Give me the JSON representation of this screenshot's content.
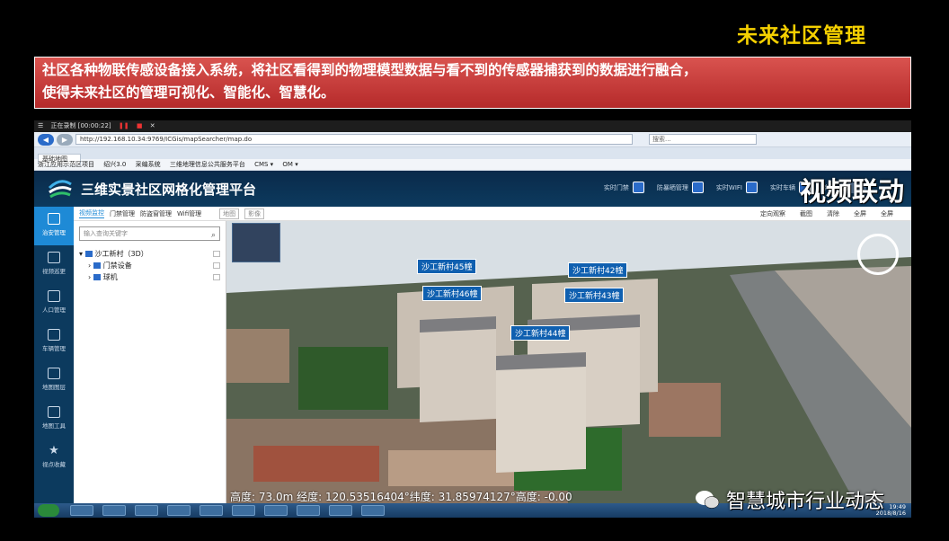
{
  "slide": {
    "title": "未来社区管理",
    "banner_line1": "社区各种物联传感设备接入系统，将社区看得到的物理模型数据与看不到的传感器捕获到的数据进行融合，",
    "banner_line2": "使得未来社区的管理可视化、智能化、智慧化。",
    "watermark_top": "视频联动",
    "watermark_bottom": "智慧城市行业动态"
  },
  "browser": {
    "recording": "正在录制 [00:00:22]",
    "url": "http://192.168.10.34:9769/ICGis/mapSearcher/map.do",
    "search_placeholder": "搜索...",
    "tab": "基础地图",
    "favorites": [
      "浙江应用示范区项目",
      "绍兴3.0",
      "采编系统",
      "三维地理信息公共服务平台",
      "CMS ▾",
      "OM ▾"
    ]
  },
  "app": {
    "title": "三维实景社区网格化管理平台",
    "header_items": [
      "实时门禁",
      "防暴晒管理",
      "实时WIFI",
      "实时车辆",
      "实时"
    ],
    "sidebar": [
      "治安管理",
      "视频巡更",
      "人口管理",
      "车辆管理",
      "地图图层",
      "地图工具",
      "视点收藏"
    ],
    "subnav": [
      "视频监控",
      "门禁管理",
      "防盗窗管理",
      "Wifi管理"
    ],
    "subnav_btns": [
      "地图",
      "影像"
    ],
    "subnav_right": [
      "定向观察",
      "截图",
      "清除",
      "全屏",
      "全屏"
    ],
    "tree_search": "输入查询关键字",
    "tree": [
      "沙工新村（3D）",
      "门禁设备",
      "球机"
    ],
    "buildings": [
      "沙工新村45幢",
      "沙工新村42幢",
      "沙工新村46幢",
      "沙工新村43幢",
      "沙工新村44幢"
    ],
    "coords": "高度:   73.0m   经度:   120.53516404°纬度:   31.85974127°高度:   -0.00",
    "clock_time": "19:49",
    "clock_date": "2018/8/16"
  },
  "colors": {
    "accent": "#1e8ad6",
    "title_yellow": "#f5d000",
    "banner_red": "#c8383a",
    "header_navy": "#0c3a5e"
  }
}
